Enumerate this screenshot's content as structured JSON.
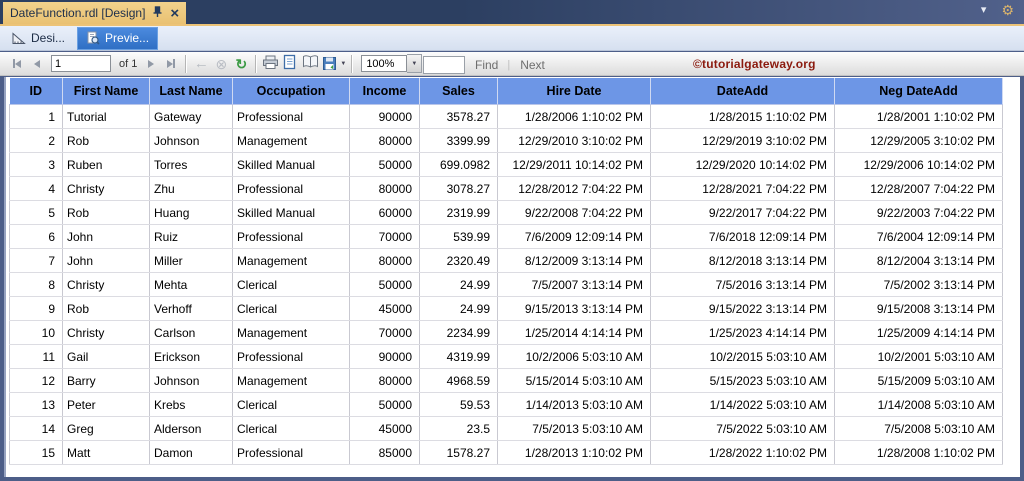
{
  "window": {
    "document_tab": "DateFunction.rdl [Design]",
    "tabs": {
      "design": "Desi...",
      "preview": "Previe..."
    },
    "watermark": "©tutorialgateway.org"
  },
  "toolbar": {
    "page_number": "1",
    "pages_label": "of 1",
    "zoom_value": "100%",
    "find_value": "",
    "find_label": "Find",
    "next_label": "Next"
  },
  "icons": {
    "pin": "pushpin",
    "close": "×",
    "chevron_down": "▾",
    "gear": "⚙",
    "back_arrow": "←",
    "stop": "⊗",
    "refresh": "↻",
    "dropdown_caret": "▼"
  },
  "colors": {
    "frame": "#4d5e88",
    "active_doc_tab": "#eec878",
    "preview_tab": "#2f6fc4",
    "table_header": "#6d96e6",
    "watermark": "#8b1a0e",
    "refresh_green": "#3c9b45"
  },
  "table": {
    "columns": [
      "ID",
      "First Name",
      "Last Name",
      "Occupation",
      "Income",
      "Sales",
      "Hire Date",
      "DateAdd",
      "Neg DateAdd"
    ],
    "aligns": [
      "r",
      "l",
      "l",
      "l",
      "r",
      "r",
      "r",
      "r",
      "r"
    ],
    "rows": [
      [
        "1",
        "Tutorial",
        "Gateway",
        "Professional",
        "90000",
        "3578.27",
        "1/28/2006 1:10:02 PM",
        "1/28/2015 1:10:02 PM",
        "1/28/2001 1:10:02 PM"
      ],
      [
        "2",
        "Rob",
        "Johnson",
        "Management",
        "80000",
        "3399.99",
        "12/29/2010 3:10:02 PM",
        "12/29/2019 3:10:02 PM",
        "12/29/2005 3:10:02 PM"
      ],
      [
        "3",
        "Ruben",
        "Torres",
        "Skilled Manual",
        "50000",
        "699.0982",
        "12/29/2011 10:14:02 PM",
        "12/29/2020 10:14:02 PM",
        "12/29/2006 10:14:02 PM"
      ],
      [
        "4",
        "Christy",
        "Zhu",
        "Professional",
        "80000",
        "3078.27",
        "12/28/2012 7:04:22 PM",
        "12/28/2021 7:04:22 PM",
        "12/28/2007 7:04:22 PM"
      ],
      [
        "5",
        "Rob",
        "Huang",
        "Skilled Manual",
        "60000",
        "2319.99",
        "9/22/2008 7:04:22 PM",
        "9/22/2017 7:04:22 PM",
        "9/22/2003 7:04:22 PM"
      ],
      [
        "6",
        "John",
        "Ruiz",
        "Professional",
        "70000",
        "539.99",
        "7/6/2009 12:09:14 PM",
        "7/6/2018 12:09:14 PM",
        "7/6/2004 12:09:14 PM"
      ],
      [
        "7",
        "John",
        "Miller",
        "Management",
        "80000",
        "2320.49",
        "8/12/2009 3:13:14 PM",
        "8/12/2018 3:13:14 PM",
        "8/12/2004 3:13:14 PM"
      ],
      [
        "8",
        "Christy",
        "Mehta",
        "Clerical",
        "50000",
        "24.99",
        "7/5/2007 3:13:14 PM",
        "7/5/2016 3:13:14 PM",
        "7/5/2002 3:13:14 PM"
      ],
      [
        "9",
        "Rob",
        "Verhoff",
        "Clerical",
        "45000",
        "24.99",
        "9/15/2013 3:13:14 PM",
        "9/15/2022 3:13:14 PM",
        "9/15/2008 3:13:14 PM"
      ],
      [
        "10",
        "Christy",
        "Carlson",
        "Management",
        "70000",
        "2234.99",
        "1/25/2014 4:14:14 PM",
        "1/25/2023 4:14:14 PM",
        "1/25/2009 4:14:14 PM"
      ],
      [
        "11",
        "Gail",
        "Erickson",
        "Professional",
        "90000",
        "4319.99",
        "10/2/2006 5:03:10 AM",
        "10/2/2015 5:03:10 AM",
        "10/2/2001 5:03:10 AM"
      ],
      [
        "12",
        "Barry",
        "Johnson",
        "Management",
        "80000",
        "4968.59",
        "5/15/2014 5:03:10 AM",
        "5/15/2023 5:03:10 AM",
        "5/15/2009 5:03:10 AM"
      ],
      [
        "13",
        "Peter",
        "Krebs",
        "Clerical",
        "50000",
        "59.53",
        "1/14/2013 5:03:10 AM",
        "1/14/2022 5:03:10 AM",
        "1/14/2008 5:03:10 AM"
      ],
      [
        "14",
        "Greg",
        "Alderson",
        "Clerical",
        "45000",
        "23.5",
        "7/5/2013 5:03:10 AM",
        "7/5/2022 5:03:10 AM",
        "7/5/2008 5:03:10 AM"
      ],
      [
        "15",
        "Matt",
        "Damon",
        "Professional",
        "85000",
        "1578.27",
        "1/28/2013 1:10:02 PM",
        "1/28/2022 1:10:02 PM",
        "1/28/2008 1:10:02 PM"
      ]
    ]
  }
}
